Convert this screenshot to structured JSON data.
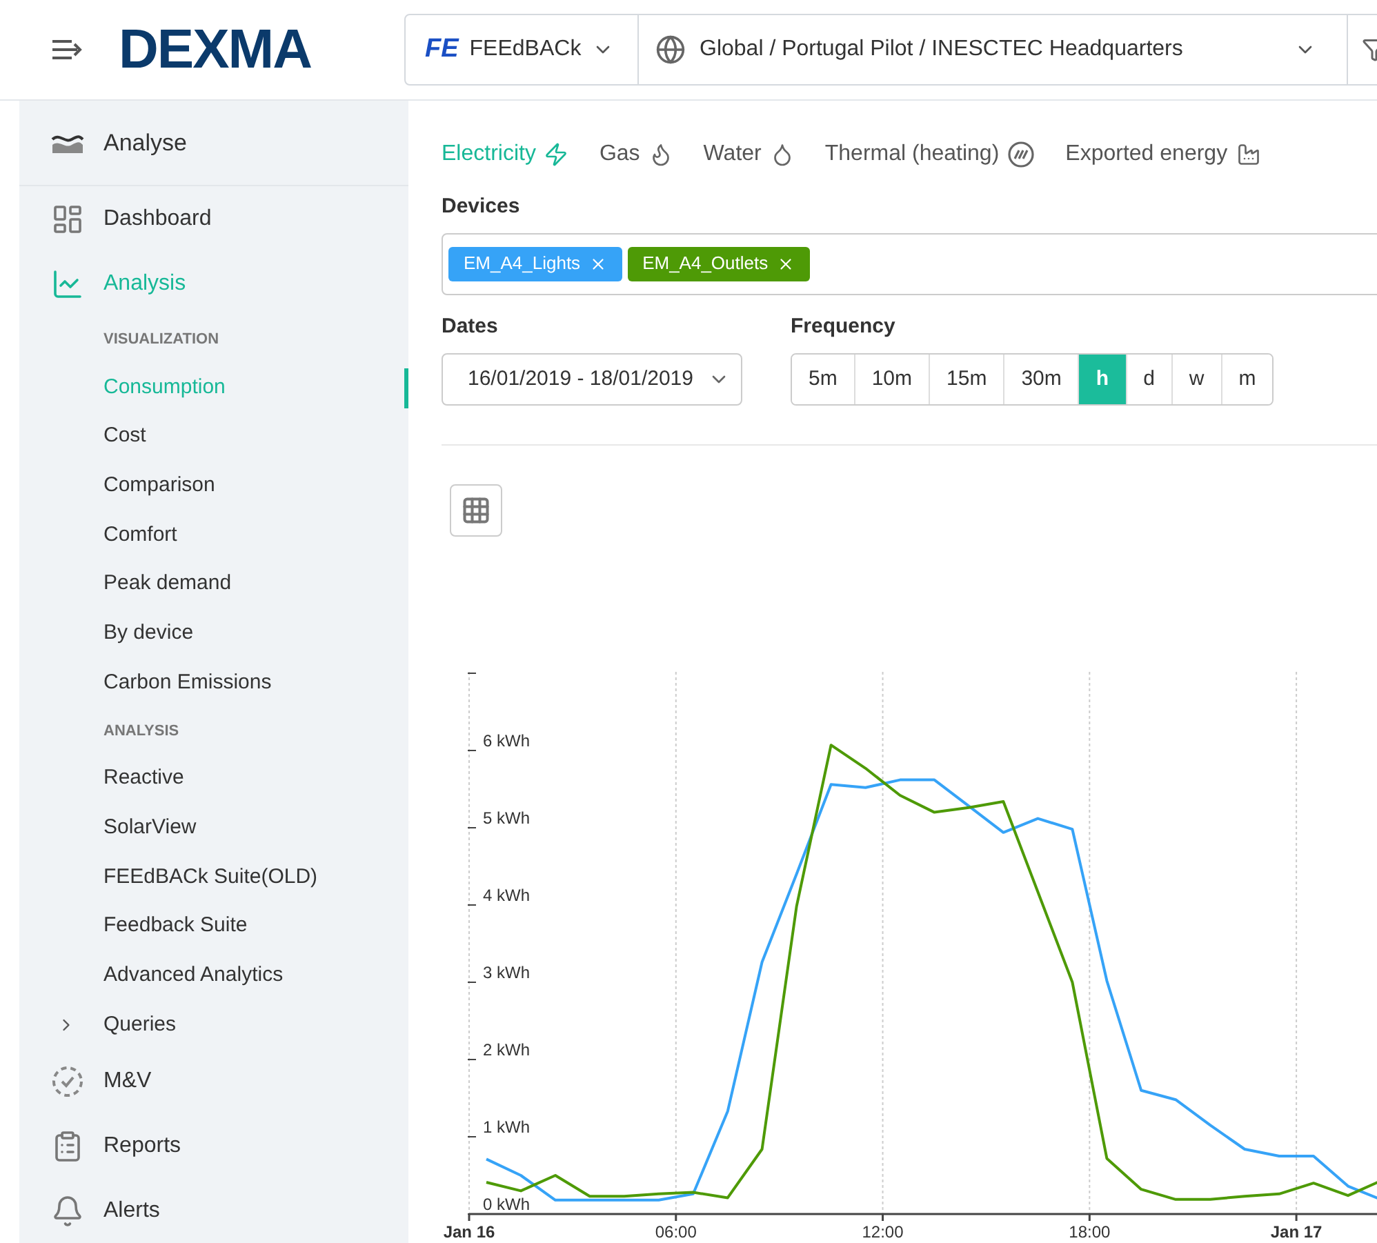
{
  "header": {
    "logo": "DEXMA",
    "org_selector": {
      "logo": "FE",
      "label": "FEEdBACk"
    },
    "location": "Global / Portugal Pilot / INESCTEC Headquarters"
  },
  "sidebar": {
    "title": "Analyse",
    "items": [
      {
        "kind": "nav",
        "label": "Dashboard",
        "selected": false
      },
      {
        "kind": "nav",
        "label": "Analysis",
        "selected": true
      },
      {
        "kind": "section",
        "label": "VISUALIZATION"
      },
      {
        "kind": "sub",
        "label": "Consumption",
        "selected": true
      },
      {
        "kind": "sub",
        "label": "Cost",
        "selected": false
      },
      {
        "kind": "sub",
        "label": "Comparison",
        "selected": false
      },
      {
        "kind": "sub",
        "label": "Comfort",
        "selected": false
      },
      {
        "kind": "sub",
        "label": "Peak demand",
        "selected": false
      },
      {
        "kind": "sub",
        "label": "By device",
        "selected": false
      },
      {
        "kind": "sub",
        "label": "Carbon Emissions",
        "selected": false
      },
      {
        "kind": "section",
        "label": "ANALYSIS"
      },
      {
        "kind": "sub",
        "label": "Reactive",
        "selected": false
      },
      {
        "kind": "sub",
        "label": "SolarView",
        "selected": false
      },
      {
        "kind": "sub",
        "label": "FEEdBACk Suite(OLD)",
        "selected": false
      },
      {
        "kind": "sub",
        "label": "Feedback Suite",
        "selected": false
      },
      {
        "kind": "sub",
        "label": "Advanced Analytics",
        "selected": false
      },
      {
        "kind": "group",
        "label": "Queries",
        "expanded": false
      },
      {
        "kind": "nav",
        "label": "M&V",
        "selected": false
      },
      {
        "kind": "nav",
        "label": "Reports",
        "selected": false
      },
      {
        "kind": "nav",
        "label": "Alerts",
        "selected": false
      }
    ]
  },
  "energy_tabs": [
    {
      "label": "Electricity",
      "selected": true
    },
    {
      "label": "Gas",
      "selected": false
    },
    {
      "label": "Water",
      "selected": false
    },
    {
      "label": "Thermal (heating)",
      "selected": false
    },
    {
      "label": "Exported energy",
      "selected": false
    }
  ],
  "devices": {
    "label": "Devices",
    "tags": [
      {
        "label": "EM_A4_Lights",
        "color": "#36a3f7"
      },
      {
        "label": "EM_A4_Outlets",
        "color": "#4e9a06"
      }
    ]
  },
  "dates": {
    "label": "Dates",
    "value": "16/01/2019 - 18/01/2019"
  },
  "frequency": {
    "label": "Frequency",
    "options": [
      {
        "label": "5m",
        "selected": false
      },
      {
        "label": "10m",
        "selected": false
      },
      {
        "label": "15m",
        "selected": false
      },
      {
        "label": "30m",
        "selected": false
      },
      {
        "label": "h",
        "selected": true
      },
      {
        "label": "d",
        "selected": false
      },
      {
        "label": "w",
        "selected": false
      },
      {
        "label": "m",
        "selected": false
      }
    ]
  },
  "chart_data": {
    "type": "line",
    "xlim": [
      0,
      26.5
    ],
    "grid": true,
    "ylim": [
      0,
      7
    ],
    "x": [
      0.5,
      1.5,
      2.5,
      3.5,
      4.5,
      5.5,
      6.5,
      7.5,
      8.5,
      9.5,
      10.5,
      11.5,
      12.5,
      13.5,
      14.5,
      15.5,
      16.5,
      17.5,
      18.5,
      19.5,
      20.5,
      21.5,
      22.5,
      23.5,
      24.5,
      25.5,
      26.5
    ],
    "xticks": [
      {
        "value": 0,
        "label": "Jan 16"
      },
      {
        "value": 6,
        "label": "06:00"
      },
      {
        "value": 12,
        "label": "12:00"
      },
      {
        "value": 18,
        "label": "18:00"
      },
      {
        "value": 24,
        "label": "Jan 17"
      }
    ],
    "yticks": [
      {
        "value": 0,
        "label": "0 kWh"
      },
      {
        "value": 1,
        "label": "1 kWh"
      },
      {
        "value": 2,
        "label": "2 kWh"
      },
      {
        "value": 3,
        "label": "3 kWh"
      },
      {
        "value": 4,
        "label": "4 kWh"
      },
      {
        "value": 5,
        "label": "5 kWh"
      },
      {
        "value": 6,
        "label": "6 kWh"
      }
    ],
    "series": [
      {
        "color": "#36a3f7",
        "values": [
          0.71,
          0.5,
          0.18,
          0.18,
          0.18,
          0.18,
          0.26,
          1.33,
          3.26,
          4.4,
          5.56,
          5.52,
          5.62,
          5.62,
          5.28,
          4.94,
          5.12,
          4.98,
          3.02,
          1.6,
          1.48,
          1.15,
          0.84,
          0.75,
          0.75,
          0.36,
          0.18
        ]
      },
      {
        "color": "#4e9a06",
        "values": [
          0.41,
          0.3,
          0.5,
          0.23,
          0.23,
          0.26,
          0.28,
          0.21,
          0.84,
          3.98,
          6.07,
          5.77,
          5.42,
          5.2,
          5.26,
          5.34,
          4.17,
          3.0,
          0.72,
          0.32,
          0.19,
          0.19,
          0.23,
          0.26,
          0.4,
          0.24,
          0.44
        ]
      }
    ]
  }
}
